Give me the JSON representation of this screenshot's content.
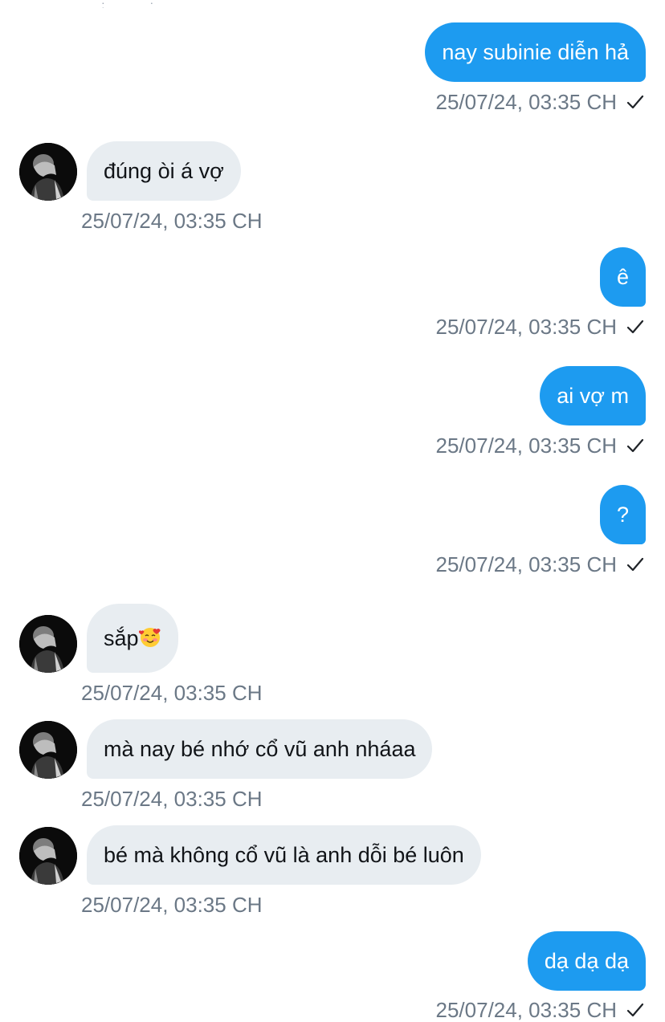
{
  "messages": [
    {
      "dir": "out",
      "text": "nay subinie diễn hả",
      "time": "25/07/24, 03:35 CH"
    },
    {
      "dir": "in",
      "text": "đúng òi á vợ",
      "time": "25/07/24, 03:35 CH"
    },
    {
      "dir": "out",
      "text": "ê",
      "time": "25/07/24, 03:35 CH"
    },
    {
      "dir": "out",
      "text": "ai vợ m",
      "time": "25/07/24, 03:35 CH"
    },
    {
      "dir": "out",
      "text": "?",
      "time": "25/07/24, 03:35 CH"
    },
    {
      "dir": "in",
      "text": "sắp",
      "emoji": "smiling-face-with-hearts",
      "time": "25/07/24, 03:35 CH"
    },
    {
      "dir": "in",
      "text": "mà nay bé nhớ cổ vũ anh nháaa",
      "time": "25/07/24, 03:35 CH"
    },
    {
      "dir": "in",
      "text": "bé mà không cổ vũ là anh dỗi bé luôn",
      "time": "25/07/24, 03:35 CH"
    },
    {
      "dir": "out",
      "text": "dạ dạ dạ",
      "time": "25/07/24, 03:35 CH"
    }
  ],
  "colors": {
    "outgoing_bubble": "#1d9bf0",
    "incoming_bubble": "#e8edf1",
    "timestamp": "#6b7886",
    "background": "#ffffff"
  },
  "icons": {
    "sent_status": "checkmark-icon",
    "avatar": "user-avatar-dark-photo"
  }
}
